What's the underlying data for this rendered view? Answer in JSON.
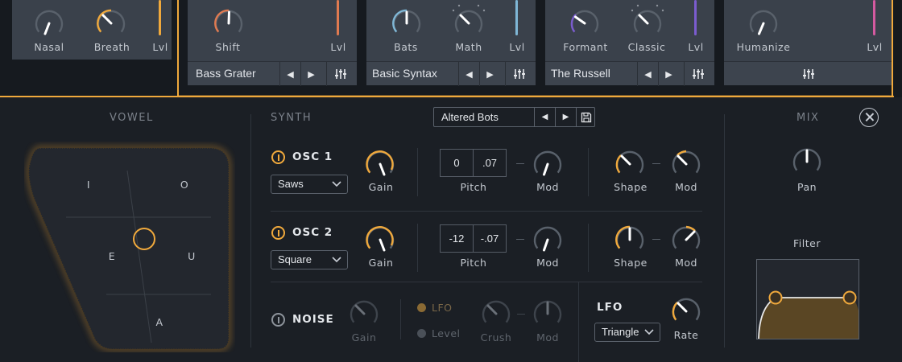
{
  "colors": {
    "accent": "#f0a93c",
    "panel": "#3a414b",
    "background": "#1b1f25",
    "blue": "#7fb7d6",
    "purple": "#7b5ccf",
    "pink": "#d45aa0",
    "coral": "#e07a50"
  },
  "top_modules": [
    {
      "knobs": [
        "Nasal",
        "Breath"
      ],
      "level_label": "Lvl"
    },
    {
      "knobs": [
        "Shift"
      ],
      "level_label": "Lvl",
      "preset": "Bass Grater"
    },
    {
      "knobs": [
        "Bats",
        "Math"
      ],
      "level_label": "Lvl",
      "preset": "Basic Syntax"
    },
    {
      "knobs": [
        "Formant",
        "Classic"
      ],
      "level_label": "Lvl",
      "preset": "The Russell"
    },
    {
      "knobs": [
        "Humanize"
      ],
      "level_label": "Lvl"
    }
  ],
  "icons": {
    "prev": "triangle-left-icon",
    "next": "triangle-right-icon",
    "settings": "sliders-icon",
    "save": "save-icon",
    "close": "close-icon",
    "expand": "triangle-up-icon"
  },
  "vowel": {
    "title": "VOWEL",
    "letters": [
      "I",
      "O",
      "E",
      "U",
      "A"
    ]
  },
  "synth": {
    "title": "SYNTH",
    "preset": "Altered Bots",
    "osc1": {
      "title": "OSC 1",
      "wave": "Saws",
      "gain_label": "Gain",
      "pitch_coarse": "0",
      "pitch_fine": ".07",
      "pitch_label": "Pitch",
      "mod_label": "Mod",
      "shape_label": "Shape",
      "shape_mod_label": "Mod"
    },
    "osc2": {
      "title": "OSC 2",
      "wave": "Square",
      "gain_label": "Gain",
      "pitch_coarse": "-12",
      "pitch_fine": "-.07",
      "pitch_label": "Pitch",
      "mod_label": "Mod",
      "shape_label": "Shape",
      "shape_mod_label": "Mod"
    },
    "noise": {
      "title": "NOISE",
      "gain_label": "Gain",
      "lfo_label": "LFO",
      "level_label": "Level",
      "crush_label": "Crush",
      "mod_label": "Mod"
    },
    "lfo": {
      "title": "LFO",
      "wave": "Triangle",
      "rate_label": "Rate"
    }
  },
  "mix": {
    "title": "MIX",
    "pan_label": "Pan",
    "filter_label": "Filter"
  }
}
